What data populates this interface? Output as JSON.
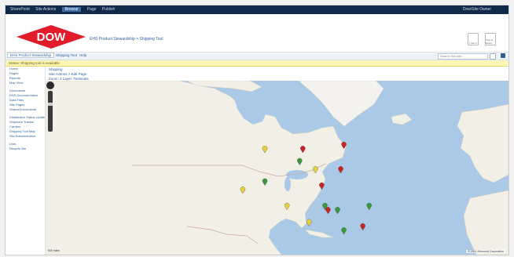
{
  "topbar": {
    "nav": [
      "SharePoint",
      "Site Actions",
      "Browse",
      "Page",
      "Publish"
    ],
    "active_index": 2,
    "user": "Dow\\Site Owner"
  },
  "header": {
    "logo_text": "DOW",
    "site_title": "EHS Product Stewardship > Shipping Tool",
    "icons": [
      "I Like It",
      "Tags & Notes"
    ]
  },
  "ribbon": {
    "tabs": [
      "EHS Product Stewardship",
      "Shipping Tool",
      "Help"
    ],
    "selected_index": 0,
    "search_placeholder": "Search this site..."
  },
  "alert": {
    "text": "Status: Shipping tool is available"
  },
  "quicklaunch": {
    "groups": [
      [
        "Home",
        "Pages",
        "Reports",
        "Map View"
      ],
      [
        "Documents",
        "EHS Documentation",
        "Data Files",
        "Site Pages",
        "Shared Documents"
      ],
      [
        "Distribution Status Updates",
        "Shipment Tracker",
        "Carriers",
        "Shipping Tool Map",
        "Site Administration"
      ],
      [
        "Lists",
        "Recycle Bin"
      ]
    ]
  },
  "content": {
    "crumbs": [
      "Shipping",
      "Site Actions > Edit Page",
      "Zoom: 4   Layer: Terminals"
    ]
  },
  "map": {
    "colors": {
      "water": "#a9c9e6",
      "land": "#f2efe6",
      "border": "#c9a9a9",
      "green": "#3a9a3a",
      "red": "#cc2222",
      "yellow": "#e8d23a"
    },
    "markers": [
      {
        "color": "yellow",
        "lon": -113,
        "lat": 52
      },
      {
        "color": "red",
        "lon": -101,
        "lat": 52
      },
      {
        "color": "red",
        "lon": -88,
        "lat": 53
      },
      {
        "color": "green",
        "lon": -102,
        "lat": 49
      },
      {
        "color": "yellow",
        "lon": -97,
        "lat": 47
      },
      {
        "color": "red",
        "lon": -89,
        "lat": 47
      },
      {
        "color": "green",
        "lon": -113,
        "lat": 44
      },
      {
        "color": "red",
        "lon": -95,
        "lat": 43
      },
      {
        "color": "yellow",
        "lon": -120,
        "lat": 42
      },
      {
        "color": "green",
        "lon": -94,
        "lat": 38
      },
      {
        "color": "yellow",
        "lon": -106,
        "lat": 38
      },
      {
        "color": "red",
        "lon": -93,
        "lat": 37
      },
      {
        "color": "green",
        "lon": -90,
        "lat": 37
      },
      {
        "color": "green",
        "lon": -80,
        "lat": 38
      },
      {
        "color": "yellow",
        "lon": -99,
        "lat": 34
      },
      {
        "color": "red",
        "lon": -82,
        "lat": 33
      },
      {
        "color": "green",
        "lon": -88,
        "lat": 32
      }
    ],
    "attribution": "© 2011 Microsoft Corporation",
    "scale_text": "500 miles"
  }
}
